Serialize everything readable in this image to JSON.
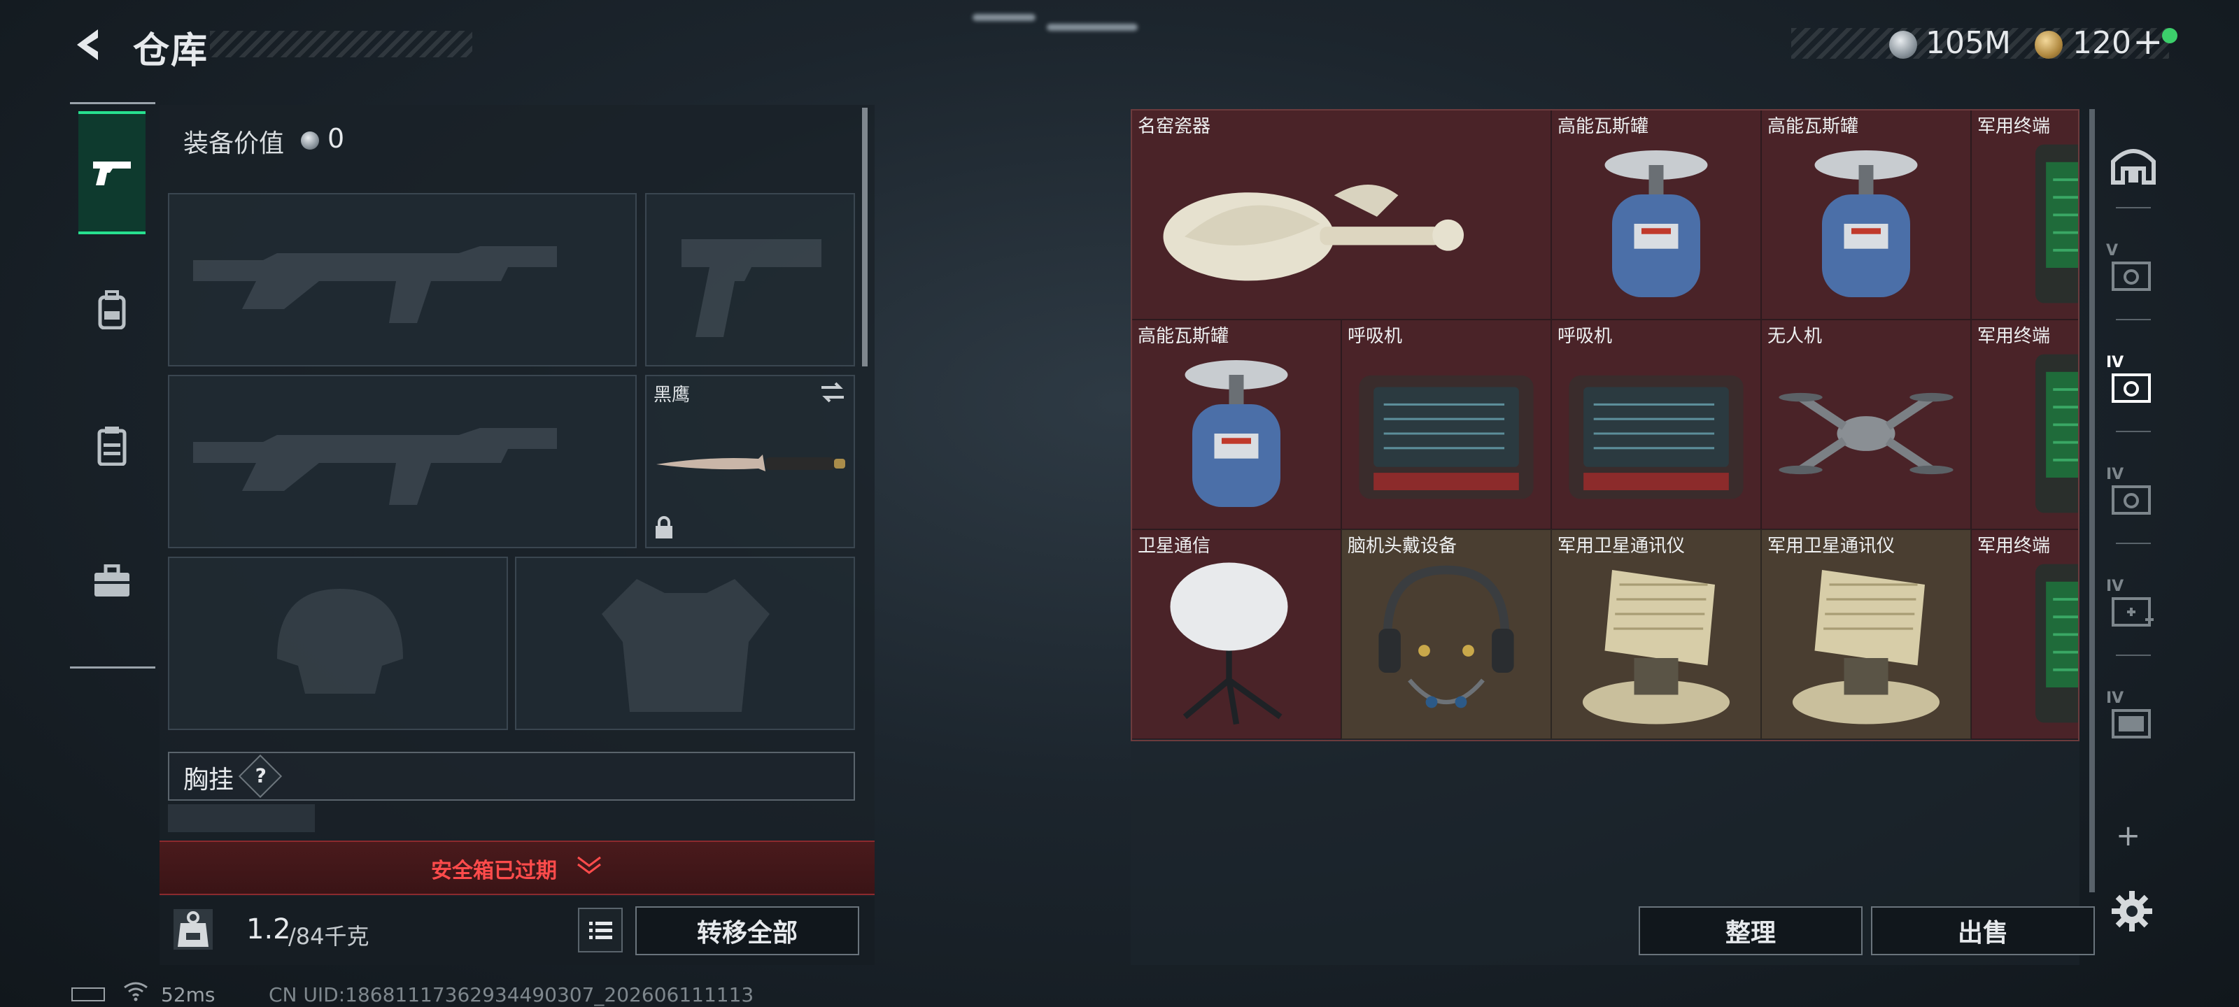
{
  "header": {
    "title": "仓库",
    "currency1": "105M",
    "currency2": "120",
    "currency2_plus": "+"
  },
  "loadout": {
    "equipment_value_label": "装备价值",
    "equipment_value": "0",
    "melee_slot_name": "黑鹰",
    "chest_rig_label": "胸挂",
    "chest_rig_help": "?",
    "safe_box_status": "安全箱已过期",
    "weight_current": "1.2",
    "weight_max": "/84千克",
    "transfer_all": "转移全部"
  },
  "left_rail_icons": [
    "pistol-icon",
    "backpack-icon",
    "vest-icon",
    "toolbox-icon"
  ],
  "stash": {
    "items": [
      {
        "name": "名窑瓷器",
        "icon": "porcelain-vase-icon",
        "bg": "red"
      },
      {
        "name": "高能瓦斯罐",
        "icon": "gas-canister-icon",
        "bg": "red"
      },
      {
        "name": "高能瓦斯罐",
        "icon": "gas-canister-icon",
        "bg": "red"
      },
      {
        "name": "军用终端",
        "icon": "military-terminal-icon",
        "bg": "red"
      },
      {
        "name": "高能瓦斯罐",
        "icon": "gas-canister-icon",
        "bg": "red"
      },
      {
        "name": "呼吸机",
        "icon": "ventilator-icon",
        "bg": "red"
      },
      {
        "name": "呼吸机",
        "icon": "ventilator-icon",
        "bg": "red"
      },
      {
        "name": "无人机",
        "icon": "drone-icon",
        "bg": "red"
      },
      {
        "name": "军用终端",
        "icon": "military-terminal-icon",
        "bg": "red"
      },
      {
        "name": "卫星通信",
        "icon": "satellite-dish-icon",
        "bg": "red"
      },
      {
        "name": "脑机头戴设备",
        "icon": "brain-headset-icon",
        "bg": "tan"
      },
      {
        "name": "军用卫星通讯仪",
        "icon": "military-satcom-icon",
        "bg": "tan"
      },
      {
        "name": "军用卫星通讯仪",
        "icon": "military-satcom-icon",
        "bg": "tan"
      },
      {
        "name": "军用终端",
        "icon": "military-terminal-icon",
        "bg": "red"
      }
    ]
  },
  "actions": {
    "sort": "整理",
    "sell": "出售"
  },
  "right_rail": {
    "tier_labels": [
      "V",
      "IV",
      "IV",
      "IV",
      "IV"
    ],
    "add_symbol": "+"
  },
  "status": {
    "ping": "52ms",
    "uid": "CN UID:18681117362934490307_202606111113"
  },
  "colors": {
    "accent_green": "#27e08f",
    "alert_red": "#ff4b4b",
    "item_red_bg": "#4a2328",
    "item_tan_bg": "#4a3e31"
  }
}
